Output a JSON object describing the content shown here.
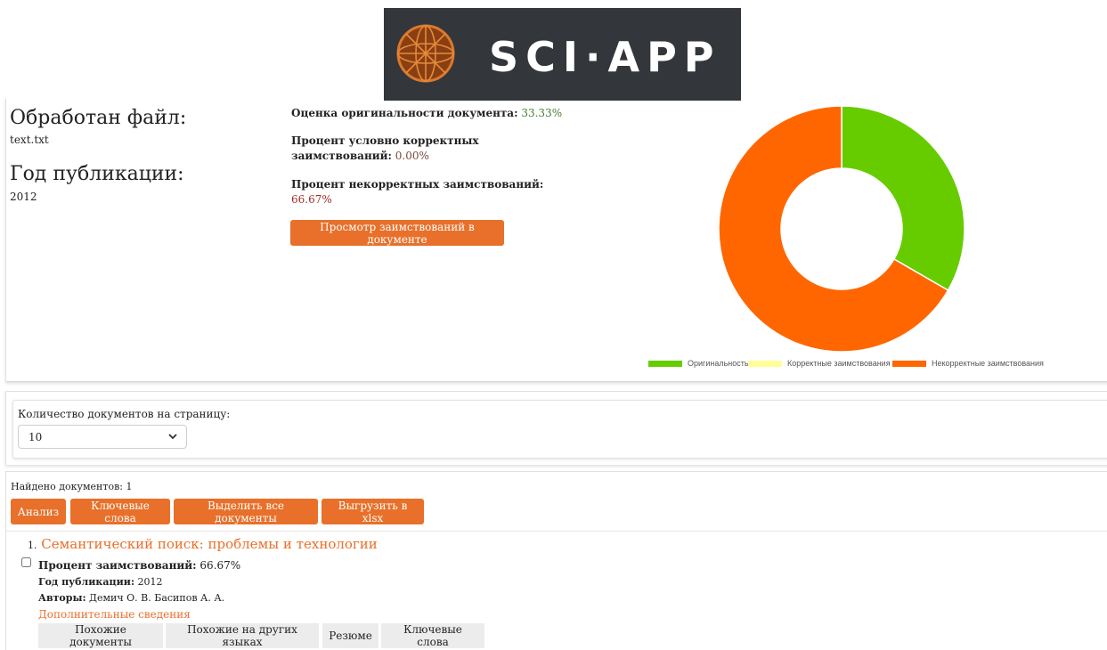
{
  "logo": {
    "text": "SCI·APP"
  },
  "file": {
    "processed_label": "Обработан файл:",
    "filename": "text.txt",
    "year_label": "Год публикации:",
    "year": "2012"
  },
  "stats": {
    "originality_label": "Оценка оригинальности документа:",
    "originality_value": "33.33%",
    "correct_label_line1": "Процент условно корректных",
    "correct_label_line2": "заимствований:",
    "correct_value": "0.00%",
    "incorrect_label": "Процент некорректных заимствований:",
    "incorrect_value": "66.67%",
    "view_button": "Просмотр заимствований в документе"
  },
  "chart_data": {
    "type": "pie",
    "categories": [
      "Оригинальность",
      "Корректные заимствования",
      "Некорректные заимствования"
    ],
    "values": [
      33.33,
      0.0,
      66.67
    ],
    "colors": [
      "#66cc00",
      "#ffff99",
      "#ff6600"
    ],
    "legend_position": "bottom-right"
  },
  "per_page": {
    "label": "Количество документов на страницу:",
    "selected": "10"
  },
  "results": {
    "found_label": "Найдено документов: 1",
    "actions": [
      "Анализ",
      "Ключевые слова",
      "Выделить все документы",
      "Выгрузить в xlsx"
    ],
    "items": [
      {
        "index": "1.",
        "title": "Семантический поиск: проблемы и технологии",
        "percent_label": "Процент заимствований:",
        "percent_value": "66.67%",
        "year_label": "Год публикации:",
        "year_value": "2012",
        "authors_label": "Авторы:",
        "authors_value": "Демич О. В. Басипов А. А.",
        "more_link": "Дополнительные сведения",
        "buttons": [
          "Похожие документы",
          "Похожие на других языках",
          "Резюме",
          "Ключевые слова"
        ]
      }
    ]
  }
}
